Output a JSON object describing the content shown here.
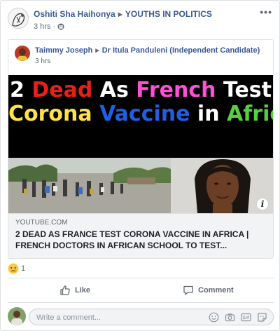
{
  "post": {
    "author": "Oshiti Sha Haihonya",
    "group": "YOUTHS IN POLITICS",
    "time": "3 hrs",
    "more_label": "•••"
  },
  "shared_post": {
    "author": "Taimmy Joseph",
    "target": "Dr Itula Panduleni (Independent Candidate)",
    "time": "3 hrs"
  },
  "link_preview": {
    "headline_line1": [
      "2",
      "Dead",
      "As",
      "French",
      "Test"
    ],
    "headline_line2": [
      "Corona",
      "Vaccine",
      "in",
      "Africa"
    ],
    "domain": "YOUTUBE.COM",
    "title": "2 DEAD AS FRANCE TEST CORONA VACCINE IN AFRICA | FRENCH DOCTORS IN AFRICAN SCHOOL TO TEST...",
    "info_label": "i"
  },
  "reactions": {
    "count": "1",
    "icon": "sad-reaction-icon"
  },
  "actions": {
    "like_label": "Like",
    "comment_label": "Comment"
  },
  "comment": {
    "placeholder": "Write a comment..."
  },
  "colors": {
    "link_blue": "#385898",
    "headline_red": "#e8201c",
    "headline_pink": "#ff4fd8",
    "headline_yellow": "#ffe14a",
    "headline_blue": "#1f5fe8",
    "headline_green": "#54d13c"
  }
}
